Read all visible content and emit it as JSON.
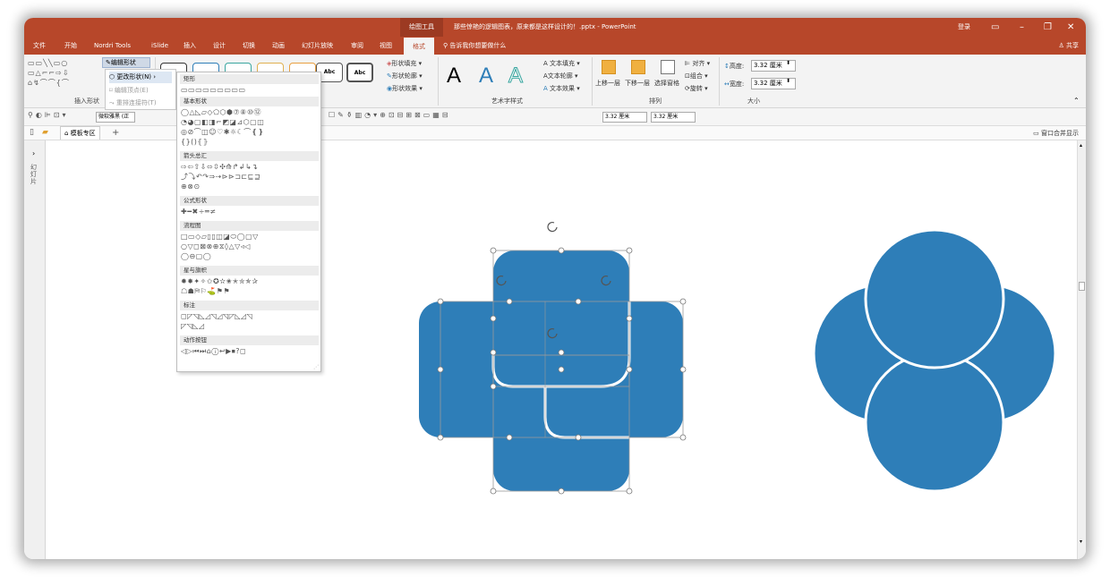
{
  "title_bar": {
    "context_tab": "绘图工具",
    "document_title": "那些惊艳的逻辑图表，原来都是这样设计的！.pptx - PowerPoint",
    "login": "登录"
  },
  "menu": {
    "tabs": [
      "文件",
      "开始",
      "Nordri Tools",
      "iSlide",
      "插入",
      "设计",
      "切换",
      "动画",
      "幻灯片放映",
      "审阅",
      "视图",
      "格式"
    ],
    "active": "格式",
    "tell_me": "告诉我你想要做什么",
    "share": "共享"
  },
  "ribbon": {
    "insert_shapes_group": "插入形状",
    "edit_shape": "编辑形状",
    "style_sample": "Abc",
    "shape_fill": "形状填充",
    "shape_outline": "形状轮廓",
    "shape_effects": "形状效果",
    "wordart_group": "艺术字样式",
    "wordart_letter": "A",
    "text_fill": "文本填充",
    "text_outline": "文本轮廓",
    "text_effects": "文本效果",
    "bring_forward": "上移一层",
    "send_backward": "下移一层",
    "selection_pane": "选择窗格",
    "align": "对齐",
    "group": "组合",
    "rotate": "旋转",
    "arrange_group": "排列",
    "height_label": "高度:",
    "height_value": "3.32 厘米",
    "width_label": "宽度:",
    "width_value": "3.32 厘米",
    "size_group": "大小"
  },
  "toolbar2": {
    "font_name": "微软雅黑 (正",
    "size1": "3.32 厘米",
    "size2": "3.32 厘米"
  },
  "tabbar": {
    "template_tab": "模板专区",
    "add_tab": "+",
    "window_merge": "窗口合并显示"
  },
  "side_panel": {
    "label": "幻灯片"
  },
  "edit_shape_menu": {
    "change_shape": "更改形状(N)",
    "edit_points": "编辑顶点(E)",
    "reroute": "重排连接符(T)"
  },
  "shape_gallery": {
    "categories": [
      {
        "name": "矩形",
        "rows": [
          "▭▭▭▭▭▭▭▭▭"
        ]
      },
      {
        "name": "基本形状",
        "rows": [
          "◯△◺▱◇⬠⬡⬢⑦⑧⑩⑫",
          "◔◕▢◧◨⌐◩◪⊿⬡▢◫",
          "◎⊘⌒◫☺♡✱☼☾⌒❴❵",
          "{}()⦃⦄"
        ]
      },
      {
        "name": "箭头总汇",
        "rows": [
          "⇨⇦⇧⇩⬄⇳✣⟰↱↲↳↴",
          "⤴⤵↶↷⇒⇢⊳⊳⊐⊏⊑⊒",
          "⊕⊗⊙"
        ]
      },
      {
        "name": "公式形状",
        "rows": [
          "✚━✖÷═≠"
        ]
      },
      {
        "name": "流程图",
        "rows": [
          "□▭◇▱▯▯◫◪⬭◯▢▽",
          "○▽◻⊠⊗⊕⧖◊△▽◃◁",
          "◯⊖▢◯"
        ]
      },
      {
        "name": "星与旗帜",
        "rows": [
          "✹✸✦✧✩✪✫✬✭✮✯✰",
          "☖☗⛿⚐⛳⚑⚑"
        ]
      },
      {
        "name": "标注",
        "rows": [
          "◻◸◹◺◿◹◿◹◸◺◿◹",
          "◸◹◺◿"
        ]
      },
      {
        "name": "动作按钮",
        "rows": [
          "◁▷⏮⏭⌂ⓘ↩▶⏹?◻"
        ]
      }
    ]
  },
  "slide": {
    "shape_color": "#2e7eb8",
    "stroke_color": "#ffffff"
  }
}
